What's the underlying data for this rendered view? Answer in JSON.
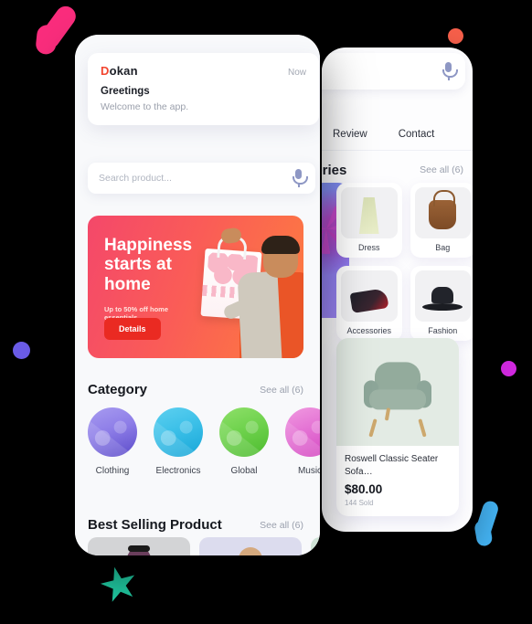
{
  "front_phone": {
    "notification": {
      "brand_initial": "D",
      "brand_rest": "okan",
      "time": "Now",
      "title": "Greetings",
      "body": "Welcome to the app."
    },
    "search": {
      "placeholder": "Search product...",
      "mic_icon": "microphone-icon"
    },
    "banner": {
      "headline": "Happiness starts at home",
      "subtext": "Up to 50% off home essentials",
      "button": "Details"
    },
    "category_section": {
      "title": "Category",
      "see_all": "See all (6)",
      "items": [
        {
          "label": "Clothing"
        },
        {
          "label": "Electronics"
        },
        {
          "label": "Global"
        },
        {
          "label": "Music"
        }
      ]
    },
    "best_selling": {
      "title": "Best Selling Product",
      "see_all": "See all (6)"
    }
  },
  "back_phone": {
    "search": {
      "mic_icon": "microphone-icon"
    },
    "tabs": [
      {
        "label": "Review"
      },
      {
        "label": "Contact"
      }
    ],
    "categories_section": {
      "title": "egories",
      "see_all": "See all (6)",
      "cards": [
        {
          "label": "Dress"
        },
        {
          "label": "Bag"
        },
        {
          "label": "Accessories"
        },
        {
          "label": "Fashion"
        }
      ]
    },
    "product": {
      "name": "Roswell Classic Seater Sofa…",
      "price": "$80.00",
      "sold": "144 Sold"
    }
  },
  "decorations": {
    "pink_banana": "#fb2d7d",
    "orange_dot": "#f8604b",
    "purple_dot": "#6b5ce7",
    "magenta_dot": "#d229e0",
    "teal_star": "#21cfa6",
    "blue_banana": "#45b6f7"
  },
  "colors": {
    "brand_red": "#f2452f",
    "banner_gradient_start": "#f4486a",
    "banner_gradient_end": "#fd7e3e",
    "details_button": "#ea2a22"
  }
}
